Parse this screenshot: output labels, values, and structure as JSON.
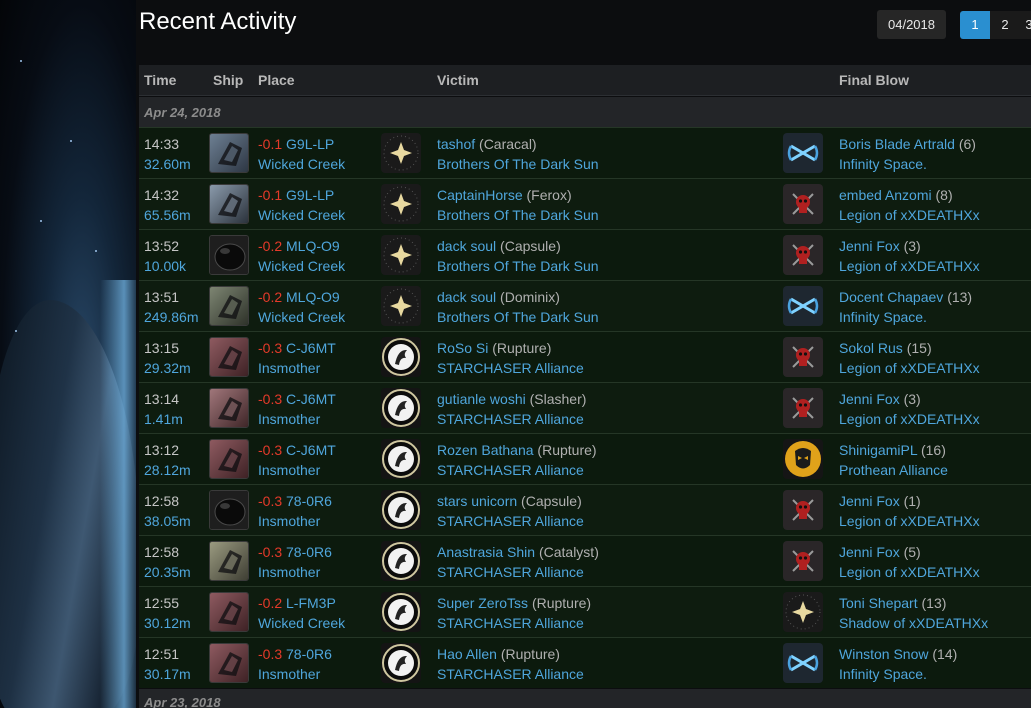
{
  "page": {
    "title": "Recent Activity",
    "date_button": "04/2018",
    "pages": [
      "1",
      "2",
      "3"
    ]
  },
  "columns": {
    "time": "Time",
    "ship": "Ship",
    "place": "Place",
    "victim": "Victim",
    "final_blow": "Final Blow"
  },
  "days": [
    "Apr 24, 2018",
    "Apr 23, 2018"
  ],
  "rows": [
    {
      "time": "14:33",
      "value": "32.60m",
      "sec": "-0.1",
      "system": "G9L-LP",
      "region": "Wicked Creek",
      "ship_icon": "caracal-icon",
      "victim_logo": "star-corp-icon",
      "victim_name": "tashof",
      "victim_ship": "(Caracal)",
      "victim_corp": "Brothers Of The Dark Sun",
      "fb_logo": "infinity-icon",
      "fb_name": "Boris Blade Artrald",
      "fb_count": "(6)",
      "fb_corp": "Infinity Space."
    },
    {
      "time": "14:32",
      "value": "65.56m",
      "sec": "-0.1",
      "system": "G9L-LP",
      "region": "Wicked Creek",
      "ship_icon": "ferox-icon",
      "victim_logo": "star-corp-icon",
      "victim_name": "CaptainHorse",
      "victim_ship": "(Ferox)",
      "victim_corp": "Brothers Of The Dark Sun",
      "fb_logo": "death-skull-icon",
      "fb_name": "embed Anzomi",
      "fb_count": "(8)",
      "fb_corp": "Legion of xXDEATHXx"
    },
    {
      "time": "13:52",
      "value": "10.00k",
      "sec": "-0.2",
      "system": "MLQ-O9",
      "region": "Wicked Creek",
      "ship_icon": "capsule-icon",
      "victim_logo": "star-corp-icon",
      "victim_name": "dack soul",
      "victim_ship": "(Capsule)",
      "victim_corp": "Brothers Of The Dark Sun",
      "fb_logo": "death-skull-icon",
      "fb_name": "Jenni Fox",
      "fb_count": "(3)",
      "fb_corp": "Legion of xXDEATHXx"
    },
    {
      "time": "13:51",
      "value": "249.86m",
      "sec": "-0.2",
      "system": "MLQ-O9",
      "region": "Wicked Creek",
      "ship_icon": "dominix-icon",
      "victim_logo": "star-corp-icon",
      "victim_name": "dack soul",
      "victim_ship": "(Dominix)",
      "victim_corp": "Brothers Of The Dark Sun",
      "fb_logo": "infinity-icon",
      "fb_name": "Docent Chapaev",
      "fb_count": "(13)",
      "fb_corp": "Infinity Space."
    },
    {
      "time": "13:15",
      "value": "29.32m",
      "sec": "-0.3",
      "system": "C-J6MT",
      "region": "Insmother",
      "ship_icon": "rupture-icon",
      "victim_logo": "starchaser-icon",
      "victim_name": "RoSo Si",
      "victim_ship": "(Rupture)",
      "victim_corp": "STARCHASER Alliance",
      "fb_logo": "death-skull-icon",
      "fb_name": "Sokol Rus",
      "fb_count": "(15)",
      "fb_corp": "Legion of xXDEATHXx"
    },
    {
      "time": "13:14",
      "value": "1.41m",
      "sec": "-0.3",
      "system": "C-J6MT",
      "region": "Insmother",
      "ship_icon": "slasher-icon",
      "victim_logo": "starchaser-icon",
      "victim_name": "gutianle woshi",
      "victim_ship": "(Slasher)",
      "victim_corp": "STARCHASER Alliance",
      "fb_logo": "death-skull-icon",
      "fb_name": "Jenni Fox",
      "fb_count": "(3)",
      "fb_corp": "Legion of xXDEATHXx"
    },
    {
      "time": "13:12",
      "value": "28.12m",
      "sec": "-0.3",
      "system": "C-J6MT",
      "region": "Insmother",
      "ship_icon": "rupture-icon",
      "victim_logo": "starchaser-icon",
      "victim_name": "Rozen Bathana",
      "victim_ship": "(Rupture)",
      "victim_corp": "STARCHASER Alliance",
      "fb_logo": "prothean-icon",
      "fb_name": "ShinigamiPL",
      "fb_count": "(16)",
      "fb_corp": "Prothean Alliance"
    },
    {
      "time": "12:58",
      "value": "38.05m",
      "sec": "-0.3",
      "system": "78-0R6",
      "region": "Insmother",
      "ship_icon": "capsule-icon",
      "victim_logo": "starchaser-icon",
      "victim_name": "stars unicorn",
      "victim_ship": "(Capsule)",
      "victim_corp": "STARCHASER Alliance",
      "fb_logo": "death-skull-icon",
      "fb_name": "Jenni Fox",
      "fb_count": "(1)",
      "fb_corp": "Legion of xXDEATHXx"
    },
    {
      "time": "12:58",
      "value": "20.35m",
      "sec": "-0.3",
      "system": "78-0R6",
      "region": "Insmother",
      "ship_icon": "catalyst-icon",
      "victim_logo": "starchaser-icon",
      "victim_name": "Anastrasia Shin",
      "victim_ship": "(Catalyst)",
      "victim_corp": "STARCHASER Alliance",
      "fb_logo": "death-skull-icon",
      "fb_name": "Jenni Fox",
      "fb_count": "(5)",
      "fb_corp": "Legion of xXDEATHXx"
    },
    {
      "time": "12:55",
      "value": "30.12m",
      "sec": "-0.2",
      "system": "L-FM3P",
      "region": "Wicked Creek",
      "ship_icon": "rupture-icon",
      "victim_logo": "starchaser-icon",
      "victim_name": "Super ZeroTss",
      "victim_ship": "(Rupture)",
      "victim_corp": "STARCHASER Alliance",
      "fb_logo": "star-corp-icon",
      "fb_name": "Toni Shepart",
      "fb_count": "(13)",
      "fb_corp": "Shadow of xXDEATHXx"
    },
    {
      "time": "12:51",
      "value": "30.17m",
      "sec": "-0.3",
      "system": "78-0R6",
      "region": "Insmother",
      "ship_icon": "rupture-icon",
      "victim_logo": "starchaser-icon",
      "victim_name": "Hao Allen",
      "victim_ship": "(Rupture)",
      "victim_corp": "STARCHASER Alliance",
      "fb_logo": "infinity-icon",
      "fb_name": "Winston Snow",
      "fb_count": "(14)",
      "fb_corp": "Infinity Space."
    }
  ]
}
